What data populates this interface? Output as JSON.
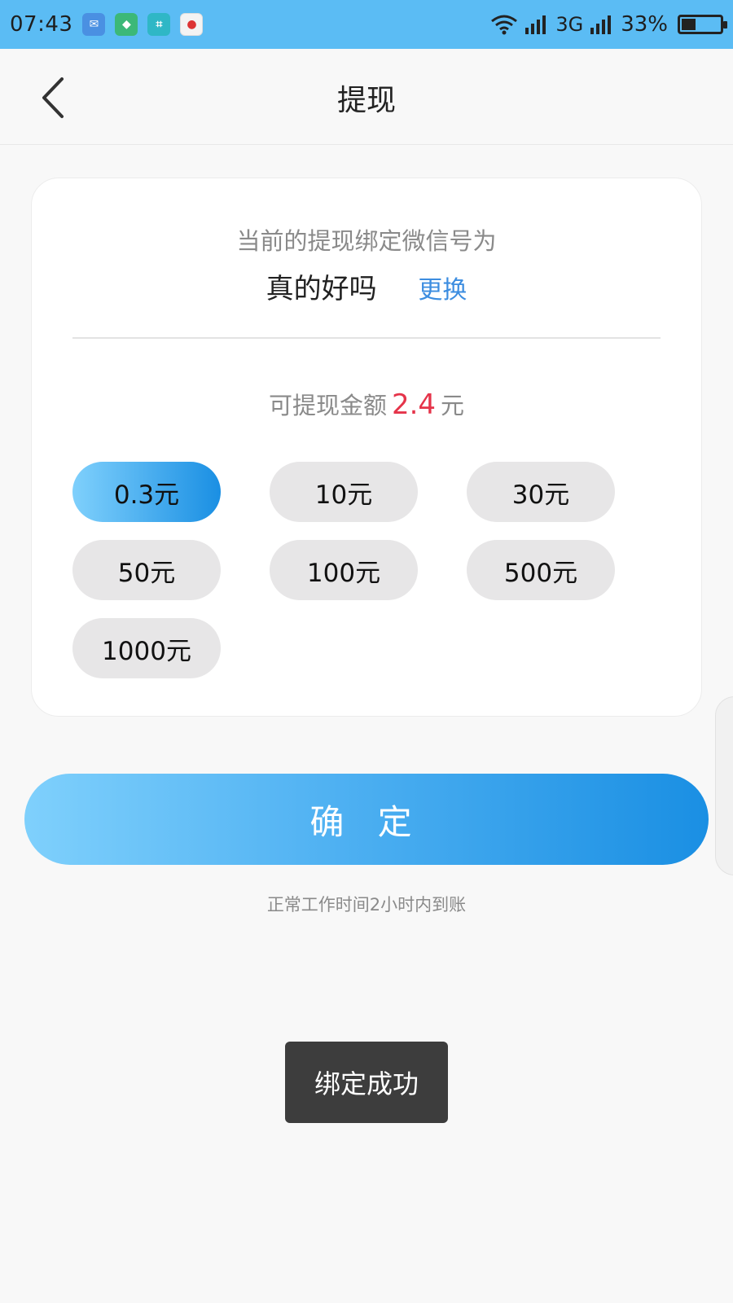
{
  "status_bar": {
    "time": "07:43",
    "notification_icons": [
      "wechat-icon",
      "shield-icon",
      "scan-icon",
      "app-icon"
    ],
    "network": "3G",
    "battery_percent": "33%",
    "battery_level": 0.33
  },
  "header": {
    "title": "提现"
  },
  "binding": {
    "caption": "当前的提现绑定微信号为",
    "account_name": "真的好吗",
    "change_label": "更换"
  },
  "balance": {
    "label": "可提现金额",
    "value": "2.4",
    "unit": "元"
  },
  "amounts": [
    {
      "label": "0.3元",
      "selected": true
    },
    {
      "label": "10元",
      "selected": false
    },
    {
      "label": "30元",
      "selected": false
    },
    {
      "label": "50元",
      "selected": false
    },
    {
      "label": "100元",
      "selected": false
    },
    {
      "label": "500元",
      "selected": false
    },
    {
      "label": "1000元",
      "selected": false
    }
  ],
  "confirm": {
    "label": "确 定"
  },
  "hint": "正常工作时间2小时内到账",
  "toast": "绑定成功",
  "colors": {
    "status_bar": "#5bbcf4",
    "accent_blue": "#3c8de0",
    "balance_red": "#e5344a",
    "gradient_start": "#7fd0fc",
    "gradient_end": "#1a8fe3"
  }
}
